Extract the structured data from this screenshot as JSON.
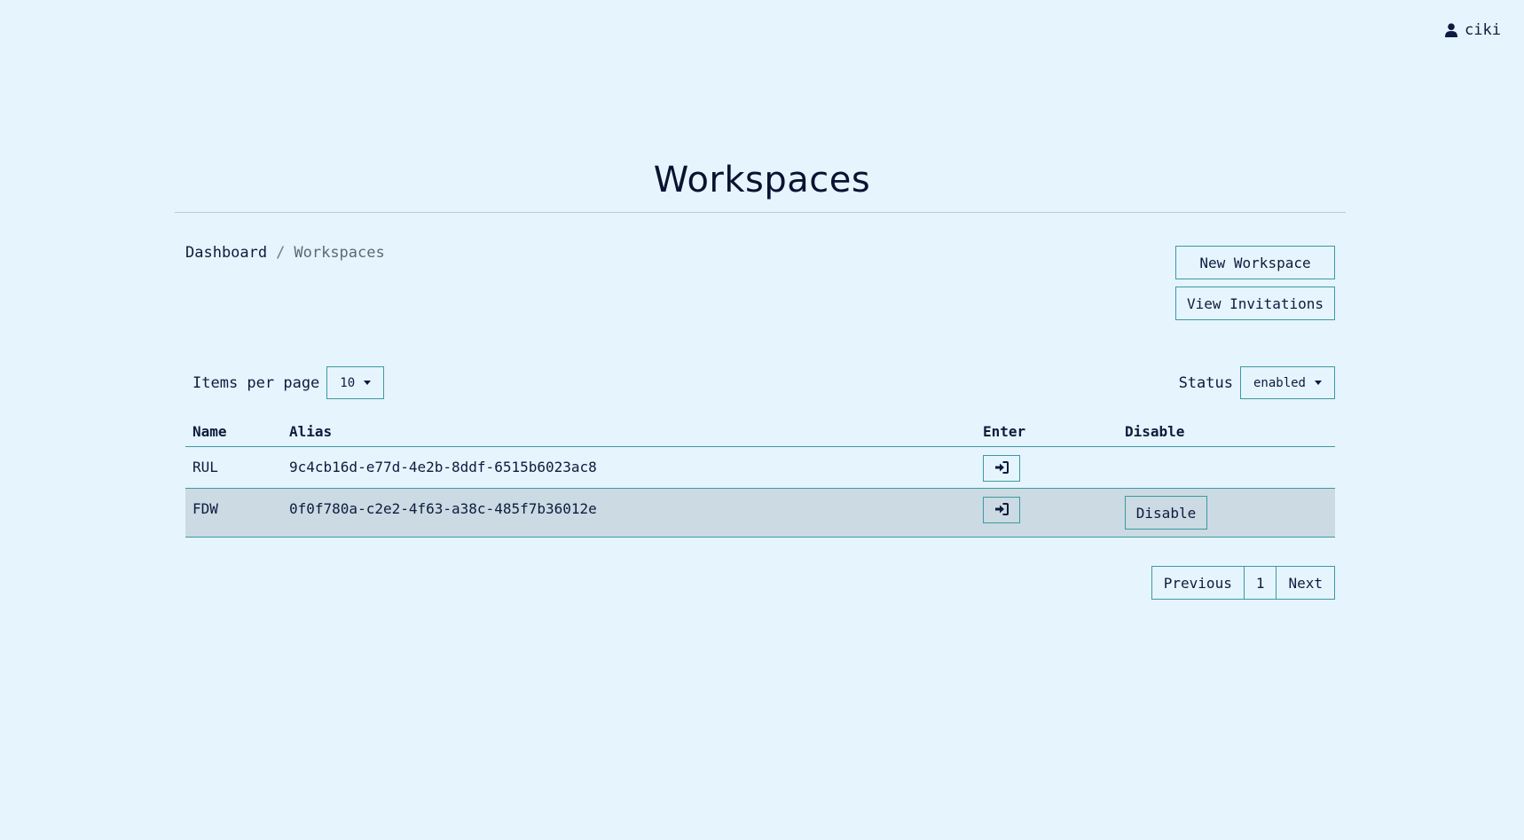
{
  "user": {
    "name": "ciki",
    "icon": "user-icon"
  },
  "page": {
    "title": "Workspaces"
  },
  "breadcrumb": {
    "dashboard": "Dashboard",
    "separator": "/",
    "current": "Workspaces"
  },
  "actions": {
    "new_workspace": "New Workspace",
    "view_invitations": "View Invitations"
  },
  "items_per_page": {
    "label": "Items per page",
    "value": "10"
  },
  "status_filter": {
    "label": "Status",
    "value": "enabled"
  },
  "table": {
    "headers": {
      "name": "Name",
      "alias": "Alias",
      "enter": "Enter",
      "disable": "Disable"
    },
    "rows": [
      {
        "name": "RUL",
        "alias": "9c4cb16d-e77d-4e2b-8ddf-6515b6023ac8",
        "disable_label": ""
      },
      {
        "name": "FDW",
        "alias": "0f0f780a-c2e2-4f63-a38c-485f7b36012e",
        "disable_label": "Disable"
      }
    ]
  },
  "pagination": {
    "previous": "Previous",
    "page": "1",
    "next": "Next"
  },
  "colors": {
    "background": "#e6f4fd",
    "accent_border": "#3b9aa0",
    "highlight_row": "#cbdae3",
    "text": "#0d1b3e"
  }
}
